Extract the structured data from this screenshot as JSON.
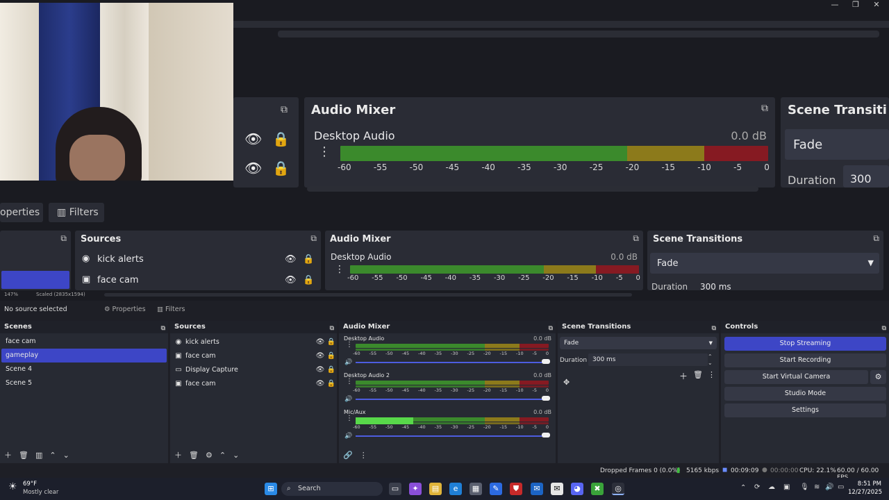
{
  "window": {
    "minimize": "—",
    "restore": "❐",
    "close": "✕"
  },
  "preview": {
    "mirror1": {
      "audio_mixer_title": "Audio Mixer",
      "desktop_audio": "Desktop Audio",
      "db": "0.0 dB",
      "ticks": [
        "-60",
        "-55",
        "-50",
        "-45",
        "-40",
        "-35",
        "-30",
        "-25",
        "-20",
        "-15",
        "-10",
        "-5",
        "0"
      ],
      "scene_transitions_title": "Scene Transiti",
      "fade": "Fade",
      "duration": "Duration",
      "duration_val": "300"
    },
    "mirror2": {
      "properties_tab": "operties",
      "filters_tab": "Filters",
      "sources_title": "Sources",
      "source1": "kick alerts",
      "source2": "face cam",
      "audio_mixer_title": "Audio Mixer",
      "desktop_audio": "Desktop Audio",
      "db": "0.0 dB",
      "ticks": [
        "-60",
        "-55",
        "-50",
        "-45",
        "-40",
        "-35",
        "-30",
        "-25",
        "-20",
        "-15",
        "-10",
        "-5",
        "0"
      ],
      "scene_transitions_title": "Scene Transitions",
      "fade": "Fade",
      "duration": "Duration",
      "duration_val": "300 ms",
      "zoom": "147%",
      "scaled": "Scaled (2835x1594)"
    }
  },
  "source_bar": {
    "no_source": "No source selected",
    "properties": "Properties",
    "filters": "Filters"
  },
  "scenes": {
    "title": "Scenes",
    "items": [
      "face cam",
      "gameplay",
      "Scene 4",
      "Scene 5"
    ],
    "selected": "gameplay"
  },
  "sources": {
    "title": "Sources",
    "items": [
      {
        "label": "kick alerts",
        "icon": "alert-icon"
      },
      {
        "label": "face cam",
        "icon": "camera-icon"
      },
      {
        "label": "Display Capture",
        "icon": "monitor-icon"
      },
      {
        "label": "face cam",
        "icon": "camera-icon"
      }
    ]
  },
  "mixer": {
    "title": "Audio Mixer",
    "ticks": [
      "-60",
      "-55",
      "-50",
      "-45",
      "-40",
      "-35",
      "-30",
      "-25",
      "-20",
      "-15",
      "-10",
      "-5",
      "0"
    ],
    "channels": [
      {
        "name": "Desktop Audio",
        "db": "0.0 dB",
        "level": 0.0
      },
      {
        "name": "Desktop Audio 2",
        "db": "0.0 dB",
        "level": 0.0
      },
      {
        "name": "Mic/Aux",
        "db": "0.0 dB",
        "level": 0.3
      }
    ]
  },
  "transitions": {
    "title": "Scene Transitions",
    "selected": "Fade",
    "duration_label": "Duration",
    "duration_value": "300 ms"
  },
  "controls": {
    "title": "Controls",
    "stop_streaming": "Stop Streaming",
    "start_recording": "Start Recording",
    "start_virtual_camera": "Start Virtual Camera",
    "studio_mode": "Studio Mode",
    "settings": "Settings"
  },
  "status": {
    "dropped_frames": "Dropped Frames 0 (0.0%)",
    "bitrate": "5165 kbps",
    "stream_time": "00:09:09",
    "rec_time": "00:00:00",
    "cpu": "CPU: 22.1%",
    "fps": "60.00 / 60.00 FPS"
  },
  "taskbar": {
    "weather_temp": "69°F",
    "weather_desc": "Mostly clear",
    "search": "Search",
    "time": "8:51 PM",
    "date": "12/27/2025"
  },
  "colors": {
    "accent": "#3d46c6",
    "green": "#3b8a2c",
    "yellow": "#8c7a1b",
    "red": "#861a22"
  }
}
